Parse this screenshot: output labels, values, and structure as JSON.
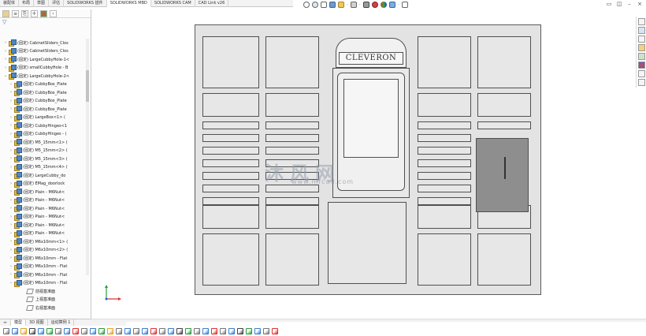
{
  "command_tabs": [
    "装配体",
    "布局",
    "草图",
    "评估",
    "SOLIDWORKS 插件",
    "SOLIDWORKS MBD",
    "SOLIDWORKS CAM",
    "CAD Link v26"
  ],
  "active_command_tab": "SOLIDWORKS MBD",
  "window_controls": [
    "restore-icon",
    "tile-icon",
    "minimize-icon",
    "close-icon"
  ],
  "hud_icons": [
    "zoom-to-fit-icon",
    "zoom-area-icon",
    "previous-view-icon",
    "section-view-icon",
    "dynamic-annotation-icon",
    "view-orientation-icon",
    "display-style-icon",
    "hide-show-icon",
    "appearance-icon",
    "scene-icon",
    "view-settings-icon"
  ],
  "panel_tabs": [
    "feature-manager-icon",
    "property-manager-icon",
    "configuration-manager-icon",
    "dimxpert-icon",
    "display-manager-icon"
  ],
  "tree": [
    {
      "label": "(固定) CabinetSliders_Clos",
      "caret": "›"
    },
    {
      "label": "(固定) CabinetSliders_Clos",
      "caret": "›"
    },
    {
      "label": "(固定) LargeCubbyHole-1<",
      "caret": "›"
    },
    {
      "label": "(固定) smallCubbyHole - B",
      "caret": "›"
    },
    {
      "label": "(固定) LargeCubbyHole-2<",
      "caret": "⌄"
    },
    {
      "label": "(固定) CubbyBox_Plate",
      "caret": "›"
    },
    {
      "label": "(固定) CubbyBox_Plate",
      "caret": "›"
    },
    {
      "label": "(固定) CubbyBox_Plate",
      "caret": "›"
    },
    {
      "label": "(固定) CubbyBox_Plate",
      "caret": "›"
    },
    {
      "label": "(固定) LargeBox<1> (",
      "caret": "›"
    },
    {
      "label": "(固定) CubbyHinges<1",
      "caret": "›"
    },
    {
      "label": "(固定) CubbyHinges - (",
      "caret": "›"
    },
    {
      "label": "(固定) M5_15mm<1> (",
      "caret": "›"
    },
    {
      "label": "(固定) M5_15mm<2> (",
      "caret": "›"
    },
    {
      "label": "(固定) M5_15mm<3> (",
      "caret": "›"
    },
    {
      "label": "(固定) M5_15mm<4> (",
      "caret": "›"
    },
    {
      "label": "(固定) LargeCubby_do",
      "caret": "›"
    },
    {
      "label": "(固定) EMag_doorlock",
      "caret": "›"
    },
    {
      "label": "(固定) Plain - M6Nut<",
      "caret": "›"
    },
    {
      "label": "(固定) Plain - M6Nut<",
      "caret": "›"
    },
    {
      "label": "(固定) Plain - M6Nut<",
      "caret": "›"
    },
    {
      "label": "(固定) Plain - M6Nut<",
      "caret": "›"
    },
    {
      "label": "(固定) Plain - M6Nut<",
      "caret": "›"
    },
    {
      "label": "(固定) Plain - M6Nut<",
      "caret": "›"
    },
    {
      "label": "(固定) M6x10mm<1> (",
      "caret": "›"
    },
    {
      "label": "(固定) M6x10mm<2> (",
      "caret": "›"
    },
    {
      "label": "(固定) M6x10mm - Flat",
      "caret": "›"
    },
    {
      "label": "(固定) M6x10mm - Flat",
      "caret": "›"
    },
    {
      "label": "(固定) M6x10mm - Flat",
      "caret": "›"
    },
    {
      "label": "(固定) M6x10mm - Flat",
      "caret": "›"
    }
  ],
  "planes": [
    "前视基准面",
    "上视基准面",
    "右视基准面"
  ],
  "bottom_tabs": [
    "模型",
    "3D 视图",
    "运动算例 1"
  ],
  "active_bottom_tab": "模型",
  "model": {
    "logo_text": "CLEVERON",
    "watermark": "沐风网",
    "watermark_url": "www.mfcad.com"
  },
  "colors": {
    "accent_blue": "#2a66b0",
    "drawing_line": "#4a4a4a",
    "drawing_fill": "#e4e4e4",
    "gray_door": "#8e8e8e"
  }
}
